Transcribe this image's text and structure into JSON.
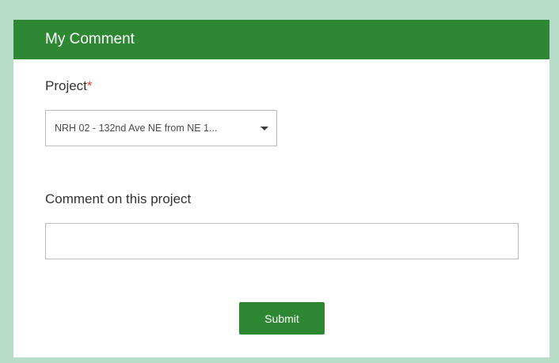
{
  "form": {
    "title": "My Comment",
    "project_field": {
      "label": "Project",
      "required_marker": "*",
      "selected_value": "NRH 02 - 132nd Ave NE from NE 1..."
    },
    "comment_field": {
      "label": "Comment on this project",
      "value": ""
    },
    "submit_label": "Submit"
  },
  "colors": {
    "page_background": "#b7dcc8",
    "header_green": "#2e8833",
    "button_green": "#2e8833",
    "required_red": "#d53f2f"
  },
  "icons": {
    "dropdown": "caret-down-icon"
  }
}
